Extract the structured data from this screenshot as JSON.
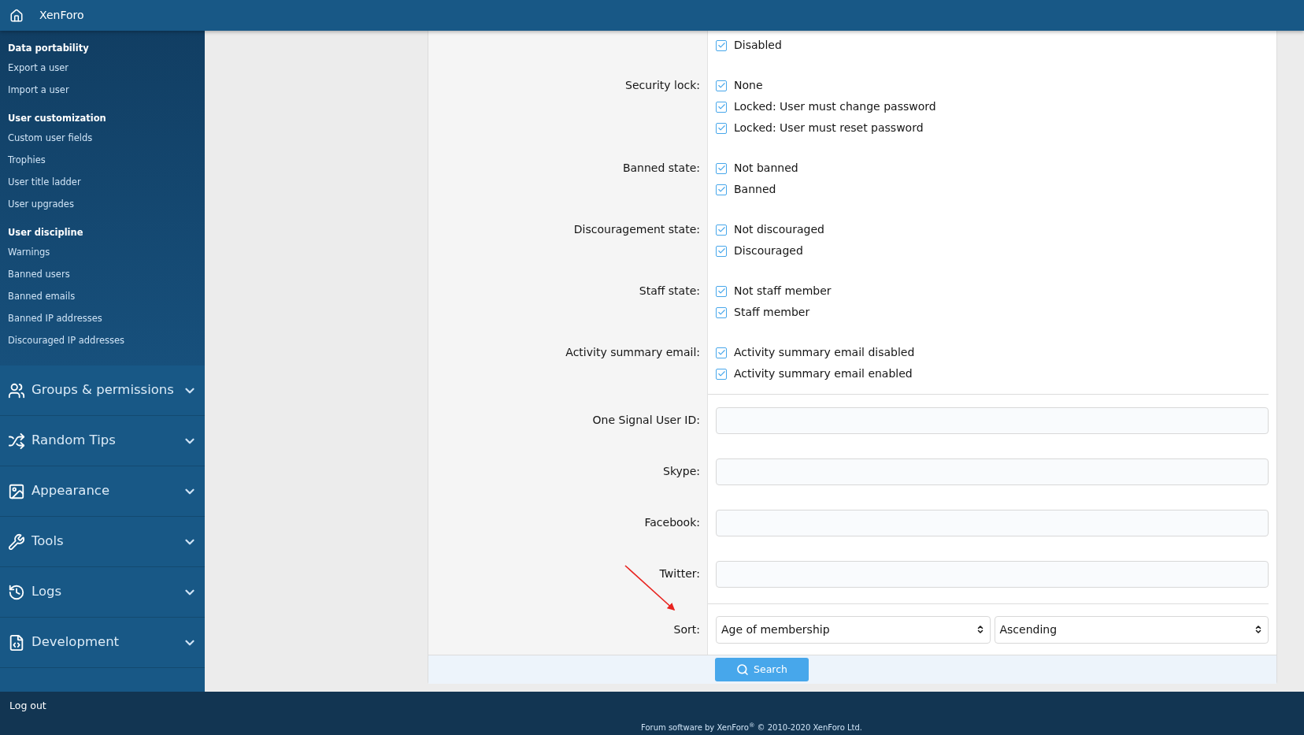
{
  "header": {
    "title": "XenForo"
  },
  "sidebar": {
    "sections": [
      {
        "title": "Data portability",
        "items": [
          "Export a user",
          "Import a user"
        ]
      },
      {
        "title": "User customization",
        "items": [
          "Custom user fields",
          "Trophies",
          "User title ladder",
          "User upgrades"
        ]
      },
      {
        "title": "User discipline",
        "items": [
          "Warnings",
          "Banned users",
          "Banned emails",
          "Banned IP addresses",
          "Discouraged IP addresses"
        ]
      }
    ],
    "menus": [
      {
        "label": "Groups & permissions",
        "expanded": false
      },
      {
        "label": "Random Tips",
        "expanded": false
      },
      {
        "label": "Appearance",
        "expanded": false
      },
      {
        "label": "Tools",
        "expanded": false
      },
      {
        "label": "Logs",
        "expanded": false
      },
      {
        "label": "Development",
        "expanded": false
      }
    ],
    "logout": "Log out"
  },
  "form": {
    "checkbox_groups": [
      {
        "options": [
          {
            "label": "Disabled",
            "checked": true
          }
        ]
      },
      {
        "label": "Security lock:",
        "options": [
          {
            "label": "None",
            "checked": true
          },
          {
            "label": "Locked: User must change password",
            "checked": true
          },
          {
            "label": "Locked: User must reset password",
            "checked": true
          }
        ]
      },
      {
        "label": "Banned state:",
        "options": [
          {
            "label": "Not banned",
            "checked": true
          },
          {
            "label": "Banned",
            "checked": true
          }
        ]
      },
      {
        "label": "Discouragement state:",
        "options": [
          {
            "label": "Not discouraged",
            "checked": true
          },
          {
            "label": "Discouraged",
            "checked": true
          }
        ]
      },
      {
        "label": "Staff state:",
        "options": [
          {
            "label": "Not staff member",
            "checked": true
          },
          {
            "label": "Staff member",
            "checked": true
          }
        ]
      },
      {
        "label": "Activity summary email:",
        "options": [
          {
            "label": "Activity summary email disabled",
            "checked": true
          },
          {
            "label": "Activity summary email enabled",
            "checked": true
          }
        ]
      }
    ],
    "text_fields": [
      {
        "label": "One Signal User ID:"
      },
      {
        "label": "Skype:"
      },
      {
        "label": "Facebook:"
      },
      {
        "label": "Twitter:"
      }
    ],
    "sort": {
      "label": "Sort:",
      "selects": [
        "Age of membership",
        "Ascending"
      ]
    },
    "submit": "Search"
  },
  "footer": {
    "copyright": "Forum software by XenForo$^{®}$ © 2010-2020 XenForo Ltd."
  }
}
